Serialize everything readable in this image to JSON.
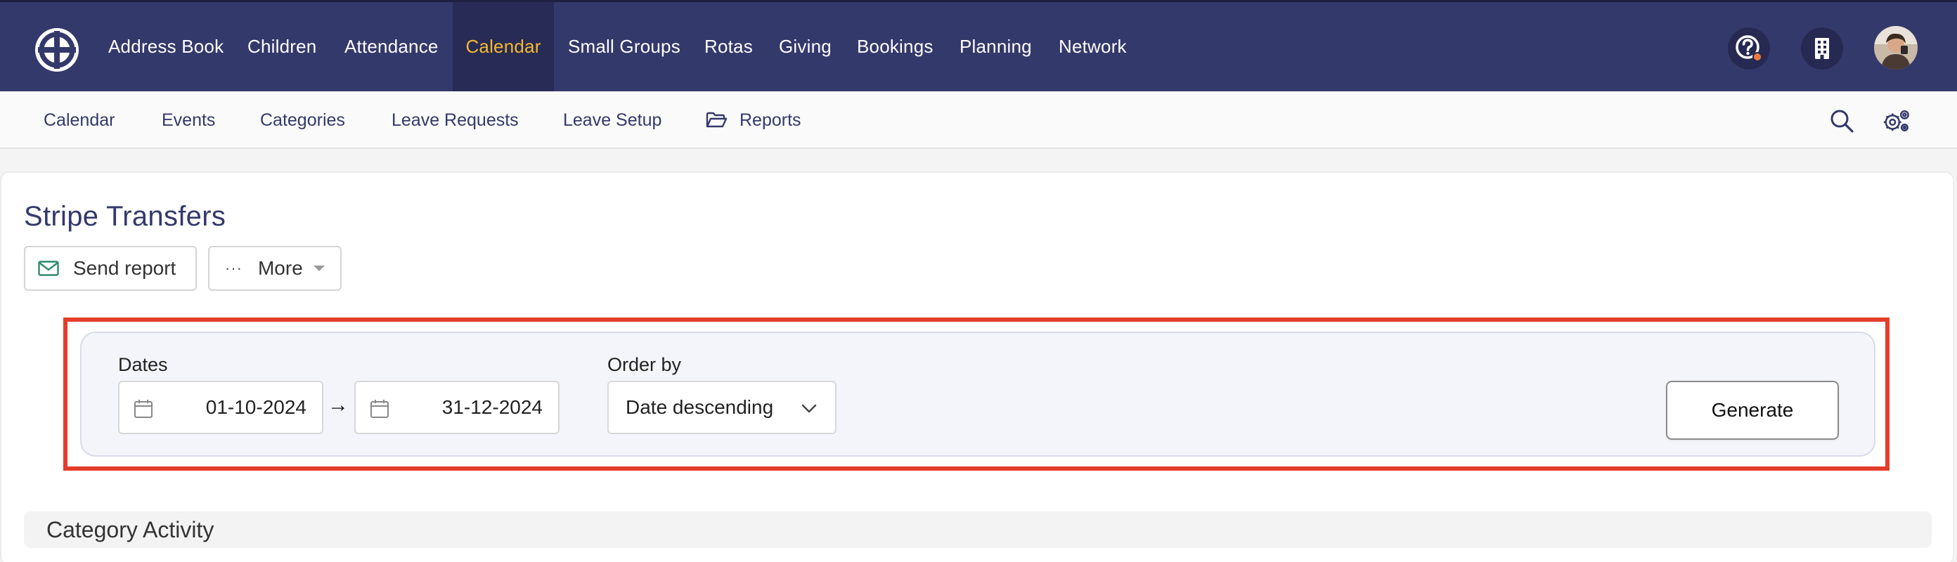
{
  "nav": {
    "items": [
      {
        "label": "Address Book"
      },
      {
        "label": "Children"
      },
      {
        "label": "Attendance"
      },
      {
        "label": "Calendar",
        "active": true
      },
      {
        "label": "Small Groups"
      },
      {
        "label": "Rotas"
      },
      {
        "label": "Giving"
      },
      {
        "label": "Bookings"
      },
      {
        "label": "Planning"
      },
      {
        "label": "Network"
      }
    ],
    "accent_color": "#f5b82e",
    "bar_color": "#34396b",
    "icons": [
      "help-icon",
      "building-icon",
      "avatar"
    ]
  },
  "subnav": {
    "items": [
      {
        "label": "Calendar"
      },
      {
        "label": "Events"
      },
      {
        "label": "Categories"
      },
      {
        "label": "Leave Requests"
      },
      {
        "label": "Leave Setup"
      },
      {
        "label": "Reports",
        "icon": "folder-open-icon"
      }
    ],
    "icons": [
      "search-icon",
      "settings-gears-icon"
    ]
  },
  "page": {
    "title": "Stripe Transfers",
    "send_report_label": "Send report",
    "more_label": "More"
  },
  "filters": {
    "dates_label": "Dates",
    "date_from": "01-10-2024",
    "date_arrow": "→",
    "date_to": "31-12-2024",
    "order_label": "Order by",
    "order_value": "Date descending",
    "generate_label": "Generate",
    "highlight_color": "#e43d2b"
  },
  "section": {
    "title": "Category Activity"
  }
}
